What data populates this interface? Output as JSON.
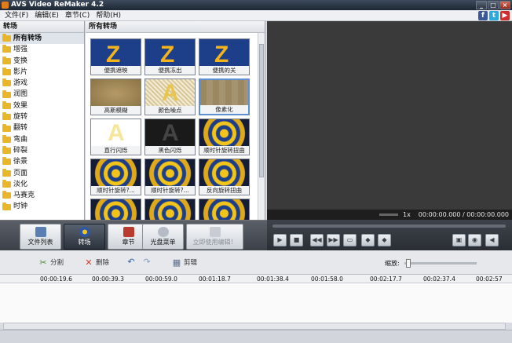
{
  "window": {
    "title": "AVS Video ReMaker 4.2"
  },
  "menu": [
    "文件(F)",
    "编辑(E)",
    "章节(C)",
    "帮助(H)"
  ],
  "social": [
    {
      "label": "f",
      "color": "#3b5998"
    },
    {
      "label": "t",
      "color": "#29a9e1"
    },
    {
      "label": "▶",
      "color": "#d12d2d"
    }
  ],
  "left_panel": {
    "header": "转场",
    "categories": [
      "所有转场",
      "增强",
      "变换",
      "影片",
      "游戏",
      "润图",
      "效果",
      "旋转",
      "翻转",
      "弯曲",
      "碎裂",
      "徐景",
      "页面",
      "淡化",
      "马赛克",
      "时钟"
    ],
    "selected_index": 0
  },
  "mid_panel": {
    "header": "所有转场",
    "tiles": [
      {
        "caption": "便携遮映",
        "style": "z"
      },
      {
        "caption": "便携冻出",
        "style": "z"
      },
      {
        "caption": "便携的关",
        "style": "z"
      },
      {
        "caption": "高斯模糊",
        "style": "blur"
      },
      {
        "caption": "颜色噪点",
        "style": "noise"
      },
      {
        "caption": "像素化",
        "style": "pix"
      },
      {
        "caption": "直行闪烁",
        "style": "fa"
      },
      {
        "caption": "黑色闪烁",
        "style": "fb"
      },
      {
        "caption": "顺时针旋转扭曲",
        "style": "sw"
      },
      {
        "caption": "顺时针旋转?...",
        "style": "sw"
      },
      {
        "caption": "顺时针旋转?...",
        "style": "sw"
      },
      {
        "caption": "反向旋转扭曲",
        "style": "sw"
      },
      {
        "caption": "",
        "style": "sw"
      },
      {
        "caption": "",
        "style": "sw"
      },
      {
        "caption": "",
        "style": "sw"
      }
    ],
    "selected_index": 5
  },
  "preview": {
    "zoom": "1x",
    "time": "00:00:00.000 / 00:00:00.000"
  },
  "main_tabs": [
    {
      "label": "文件列表",
      "active": false
    },
    {
      "label": "转场",
      "active": true
    },
    {
      "label": "章节",
      "active": false
    },
    {
      "label": "光盘菜单",
      "active": false
    },
    {
      "label": "立即使用编辑！",
      "active": false
    }
  ],
  "timeline_tools": {
    "split": "分割",
    "delete": "删除",
    "trim": "剪辑",
    "zoom_label": "缩放:"
  },
  "ruler_times": [
    "00:00:19.6",
    "00:00:39.3",
    "00:00:59.0",
    "00:01:18.7",
    "00:01:38.4",
    "00:01:58.0",
    "00:02:17.7",
    "00:02:37.4",
    "00:02:57"
  ]
}
